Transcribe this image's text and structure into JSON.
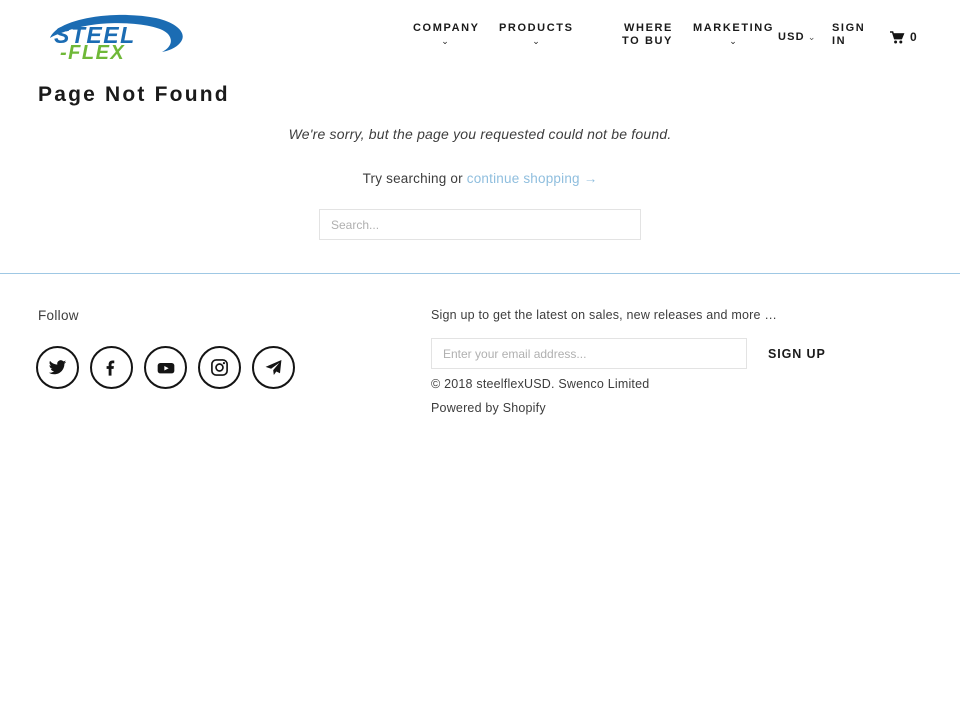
{
  "header": {
    "logo": {
      "name": "steel-flex-logo",
      "text_primary": "STEEL",
      "text_secondary": "-FLEX",
      "color_blue": "#1b6cb3",
      "color_green": "#6fb838"
    },
    "nav": [
      {
        "label": "COMPANY",
        "has_dropdown": true,
        "caret": "⌄"
      },
      {
        "label": "PRODUCTS",
        "has_dropdown": true,
        "caret": "⌄"
      },
      {
        "label": "WHERE TO BUY",
        "has_dropdown": false,
        "caret": ""
      },
      {
        "label": "MARKETING",
        "has_dropdown": true,
        "caret": "⌄"
      }
    ],
    "currency": {
      "label": "USD",
      "caret": "⌄"
    },
    "sign_in": {
      "label": "SIGN IN"
    },
    "cart": {
      "icon": "shopping-cart-icon",
      "count": "0"
    }
  },
  "page": {
    "title": "Page Not Found",
    "sorry_message": "We're sorry, but the page you requested could not be found.",
    "try_prefix": "Try searching or ",
    "continue_link": "continue shopping →",
    "continue_link_color": "#8fbede",
    "search_placeholder": "Search..."
  },
  "footer": {
    "follow_heading": "Follow",
    "social": [
      {
        "name": "twitter-icon",
        "label": "Twitter"
      },
      {
        "name": "facebook-icon",
        "label": "Facebook"
      },
      {
        "name": "youtube-icon",
        "label": "YouTube"
      },
      {
        "name": "instagram-icon",
        "label": "Instagram"
      },
      {
        "name": "email-icon",
        "label": "Email"
      }
    ],
    "newsletter": {
      "heading": "Sign up to get the latest on sales, new releases and more …",
      "email_placeholder": "Enter your email address...",
      "submit_label": "SIGN UP"
    },
    "copyright": "© 2018 steelflexUSD. Swenco Limited",
    "powered_by_prefix": "Powered by ",
    "powered_by_link": "Shopify",
    "divider_color": "#9fc8e4"
  }
}
